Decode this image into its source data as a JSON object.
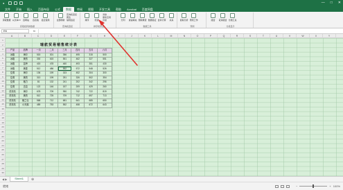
{
  "titlebar": {
    "doc_title": "",
    "window_buttons": [
      "—",
      "□",
      "✕"
    ]
  },
  "ribbon_tabs": [
    "文件",
    "开始",
    "插入",
    "页面布局",
    "公式",
    "数据",
    "审阅",
    "视图",
    "开发工具",
    "帮助",
    "Acrobat",
    "百度网盘"
  ],
  "active_tab_index": 5,
  "ribbon": {
    "groups": [
      {
        "buttons": [
          "获取数据",
          "从文本/CSV",
          "自网站",
          "自表格",
          "最近使用"
        ],
        "name": "获取和转换数据"
      },
      {
        "buttons": [
          "全部刷新"
        ],
        "small": [
          "查询和连接",
          "属性",
          "编辑链接"
        ],
        "name": "查询和连接"
      },
      {
        "buttons": [
          "排序",
          "筛选"
        ],
        "small": [
          "清除",
          "重新应用",
          "高级"
        ],
        "name": "排序和筛选"
      },
      {
        "buttons": [
          "分列",
          "快速填充",
          "删除重复值",
          "数据验证",
          "合并计算",
          "关系"
        ],
        "name": "数据工具"
      },
      {
        "buttons": [
          "模拟分析",
          "预测工作表"
        ],
        "name": "预测"
      },
      {
        "buttons": [
          "组合",
          "取消组合",
          "分类汇总"
        ],
        "name": "分级显示"
      }
    ]
  },
  "formula_bar": {
    "name_box": "E6",
    "fx": "fx",
    "value": ""
  },
  "column_headers": [
    "A",
    "B",
    "C",
    "D",
    "E",
    "F",
    "G",
    "H",
    "I",
    "J",
    "K",
    "L",
    "M",
    "N",
    "O",
    "P",
    "Q",
    "R",
    "S",
    "T",
    "U",
    "V",
    "W",
    "X",
    "Y"
  ],
  "row_headers": [
    "1",
    "2",
    "3",
    "4",
    "5",
    "6",
    "7",
    "8",
    "9",
    "10",
    "11",
    "12",
    "13",
    "14",
    "15",
    "16",
    "17",
    "18",
    "19",
    "20",
    "21",
    "22",
    "23",
    "24",
    "25",
    "26",
    "27",
    "28",
    "29",
    "30",
    "31"
  ],
  "table": {
    "title": "瑞航贸易销售统计表",
    "headers": [
      "产品",
      "品牌",
      "一月",
      "二月",
      "三月",
      "四月",
      "五月",
      "六月"
    ],
    "rows": [
      [
        "冰箱",
        "海尔",
        "515",
        "301",
        "356",
        "495",
        "315",
        "500"
      ],
      [
        "冰箱",
        "美的",
        "330",
        "615",
        "551",
        "462",
        "327",
        "551"
      ],
      [
        "冰箱",
        "容声",
        "415",
        "478",
        "460",
        "493",
        "351",
        "430"
      ],
      [
        "冰箱",
        "美菱",
        "512",
        "486",
        "592",
        "572",
        "548",
        "526"
      ],
      [
        "空调",
        "海尔",
        "136",
        "159",
        "323",
        "452",
        "304",
        "300"
      ],
      [
        "空调",
        "美的",
        "313",
        "199",
        "251",
        "326",
        "502",
        "354"
      ],
      [
        "空调",
        "格力",
        "81",
        "132",
        "241",
        "202",
        "342",
        "296"
      ],
      [
        "空调",
        "志高",
        "122",
        "146",
        "157",
        "209",
        "429",
        "260"
      ],
      [
        "洗衣机",
        "海尔",
        "678",
        "709",
        "950",
        "742",
        "722",
        "819"
      ],
      [
        "洗衣机",
        "美的",
        "512",
        "725",
        "709",
        "712",
        "697",
        "713"
      ],
      [
        "洗衣机",
        "格兰仕",
        "568",
        "712",
        "681",
        "641",
        "685",
        "650"
      ],
      [
        "洗衣机",
        "小天鹅",
        "489",
        "753",
        "552",
        "458",
        "672",
        "643"
      ]
    ]
  },
  "selected_cell": {
    "row": 3,
    "col": 4
  },
  "sheet_tabs": [
    "Sheet1"
  ],
  "status": {
    "ready": "就绪",
    "zoom": "100%"
  },
  "colors": {
    "excel_green": "#1e7145",
    "sheet_bg": "#d8efd9",
    "header_row_bg": "#e4d3e8",
    "arrow": "#e0322e"
  }
}
